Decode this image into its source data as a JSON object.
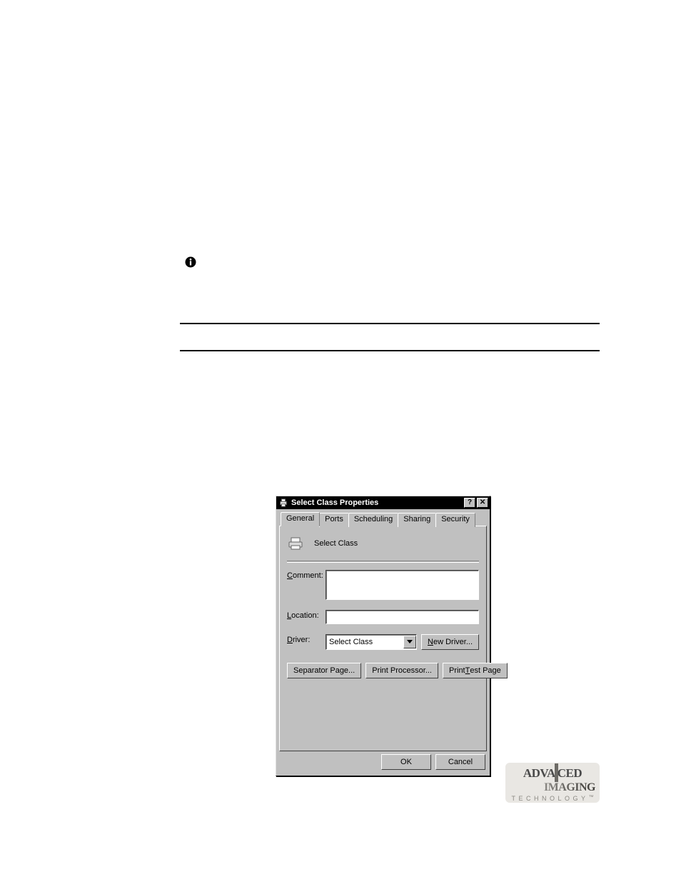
{
  "dialog": {
    "title": "Select Class Properties",
    "titlebar": {
      "help_label": "?",
      "close_label": "✕"
    },
    "tabs": [
      "General",
      "Ports",
      "Scheduling",
      "Sharing",
      "Security"
    ],
    "general": {
      "printer_name": "Select Class",
      "labels": {
        "comment": "Comment:",
        "comment_access": "C",
        "location": "Location:",
        "location_access": "L",
        "driver": "Driver:",
        "driver_access": "D"
      },
      "driver_value": "Select Class",
      "new_driver_label": "New Driver...",
      "new_driver_access": "N",
      "separator_page_label": "Separator Page...",
      "print_processor_label": "Print Processor...",
      "print_test_page_label": "Print Test Page",
      "print_test_page_access": "T"
    },
    "buttons": {
      "ok": "OK",
      "cancel": "Cancel"
    }
  },
  "logo": {
    "line1a": "ADVA",
    "line1b": "CED",
    "line2": "IMAGING",
    "line3": "TECHNOLOGY",
    "tm": "™"
  }
}
